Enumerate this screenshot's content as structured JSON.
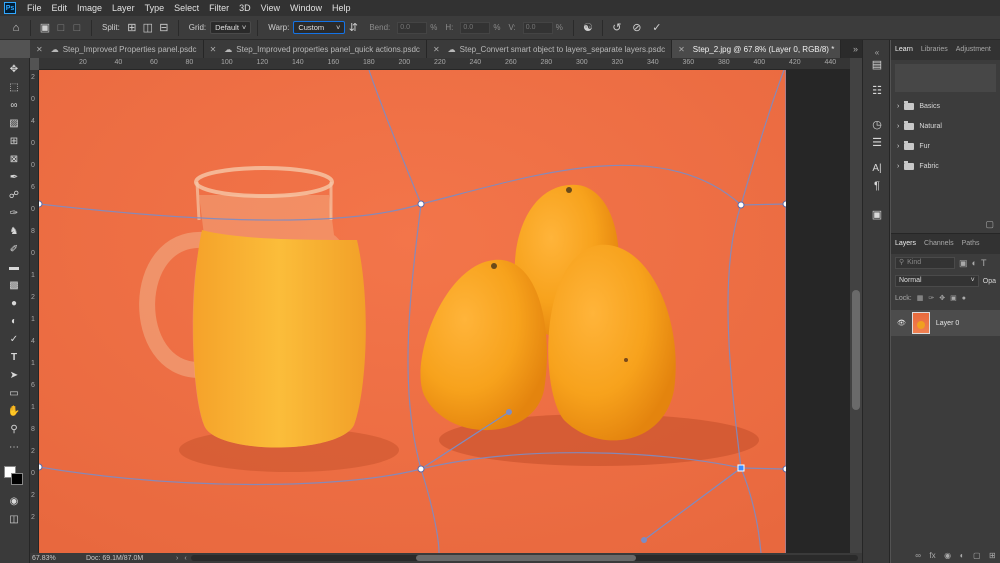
{
  "app": {
    "logo_text": "Ps"
  },
  "menu": [
    "File",
    "Edit",
    "Image",
    "Layer",
    "Type",
    "Select",
    "Filter",
    "3D",
    "View",
    "Window",
    "Help"
  ],
  "options": {
    "split_label": "Split:",
    "grid_label": "Grid:",
    "grid_value": "Default",
    "warp_label": "Warp:",
    "warp_value": "Custom",
    "bend_label": "Bend:",
    "bend_value": "0.0",
    "h_label": "H:",
    "h_value": "0.0",
    "v_label": "V:",
    "v_value": "0.0",
    "percent": "%"
  },
  "tabs": [
    {
      "label": "Step_Improved Properties panel.psdc",
      "active": false
    },
    {
      "label": "Step_Improved properties panel_quick actions.psdc",
      "active": false
    },
    {
      "label": "Step_Convert smart object to layers_separate layers.psdc",
      "active": false
    },
    {
      "label": "Step_2.jpg @ 67.8% (Layer 0, RGB/8) *",
      "active": true
    }
  ],
  "ruler_top": [
    "20",
    "40",
    "60",
    "80",
    "100",
    "120",
    "140",
    "160",
    "180",
    "200",
    "220",
    "240",
    "260",
    "280",
    "300",
    "320",
    "340",
    "360",
    "380",
    "400",
    "420",
    "440"
  ],
  "ruler_left": [
    "2",
    "0",
    "4",
    "0",
    "0",
    "6",
    "0",
    "8",
    "0",
    "1",
    "2",
    "1",
    "4",
    "1",
    "6",
    "1",
    "8",
    "2",
    "0",
    "2",
    "2"
  ],
  "status": {
    "zoom": "67.83%",
    "doc": "Doc: 69.1M/87.0M"
  },
  "panel_top": {
    "tabs": [
      "Learn",
      "Libraries",
      "Adjustment"
    ],
    "brushes": [
      "Basics",
      "Natural",
      "Fur",
      "Fabric"
    ]
  },
  "layers_panel": {
    "tabs": [
      "Layers",
      "Channels",
      "Paths"
    ],
    "kind_placeholder": "Kind",
    "blend_mode": "Normal",
    "opacity_label": "Opa",
    "lock_label": "Lock:",
    "layers": [
      {
        "name": "Layer 0",
        "visible": true
      }
    ]
  },
  "colors": {
    "background": "#f07046",
    "accent": "#1473e6",
    "warp_grid": "#7c8cc4"
  }
}
